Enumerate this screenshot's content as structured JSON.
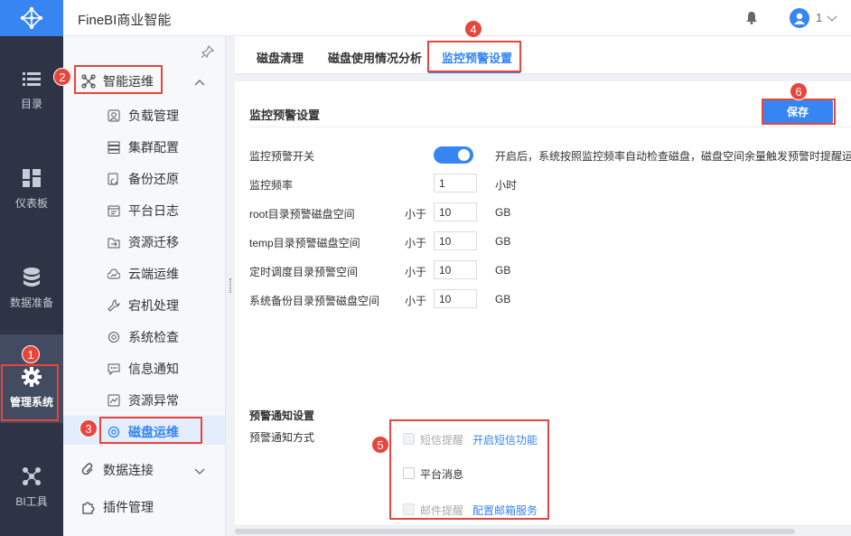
{
  "app": {
    "title": "FineBI商业智能",
    "user": "1"
  },
  "leftnav": [
    {
      "label": "目录",
      "icon": "list-icon"
    },
    {
      "label": "仪表板",
      "icon": "dashboard-icon"
    },
    {
      "label": "数据准备",
      "icon": "database-icon"
    },
    {
      "label": "管理系统",
      "icon": "gear-icon"
    },
    {
      "label": "BI工具",
      "icon": "bi-tools-icon"
    }
  ],
  "sidebar": {
    "group": "智能运维",
    "items": [
      "负载管理",
      "集群配置",
      "备份还原",
      "平台日志",
      "资源迁移",
      "云端运维",
      "宕机处理",
      "系统检查",
      "信息通知",
      "资源异常",
      "磁盘运维"
    ],
    "bottom": [
      "数据连接",
      "插件管理"
    ]
  },
  "tabs": [
    "磁盘清理",
    "磁盘使用情况分析",
    "监控预警设置"
  ],
  "section": {
    "title": "监控预警设置",
    "save": "保存"
  },
  "settings": {
    "switch_label": "监控预警开关",
    "switch_desc": "开启后，系统按照监控频率自动检查磁盘，磁盘空间余量触发预警时提醒运",
    "freq_label": "监控频率",
    "freq_value": "1",
    "freq_unit": "小时",
    "less_than": "小于",
    "gb": "GB",
    "rows": [
      {
        "label": "root目录预警磁盘空间",
        "value": "10"
      },
      {
        "label": "temp目录预警磁盘空间",
        "value": "10"
      },
      {
        "label": "定时调度目录预警空间",
        "value": "10"
      },
      {
        "label": "系统备份目录预警磁盘空间",
        "value": "10"
      }
    ]
  },
  "notify": {
    "title": "预警通知设置",
    "method_label": "预警通知方式",
    "sms": "短信提醒",
    "sms_link": "开启短信功能",
    "platform": "平台消息",
    "email": "邮件提醒",
    "email_link": "配置邮箱服务"
  },
  "badges": [
    "1",
    "2",
    "3",
    "4",
    "5",
    "6"
  ],
  "colors": {
    "accent": "#3685f2",
    "nav_bg": "#2e3446",
    "marker": "#e8453c"
  }
}
